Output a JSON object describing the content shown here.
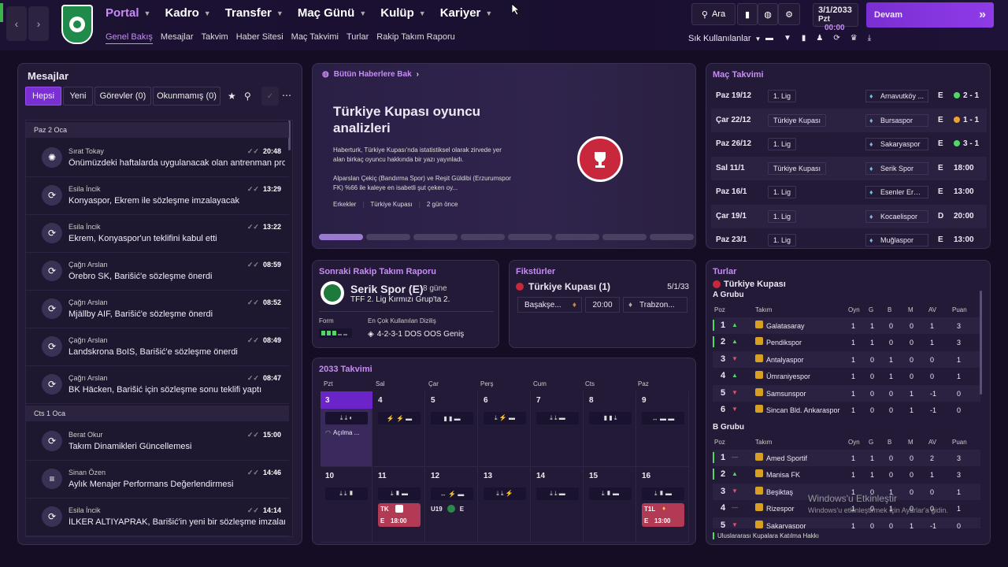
{
  "header": {
    "back_icon": "chevron-left-icon",
    "fwd_icon": "chevron-right-icon",
    "menu": [
      {
        "label": "Portal",
        "active": true
      },
      {
        "label": "Kadro"
      },
      {
        "label": "Transfer"
      },
      {
        "label": "Maç Günü"
      },
      {
        "label": "Kulüp"
      },
      {
        "label": "Kariyer"
      }
    ],
    "submenu": [
      "Genel Bakış",
      "Mesajlar",
      "Takvim",
      "Haber Sitesi",
      "Maç Takvimi",
      "Turlar",
      "Rakip Takım Raporu"
    ],
    "search_label": "Ara",
    "date": "3/1/2033",
    "day": "Pzt",
    "time": "00:00",
    "continue_label": "Devam",
    "quick_label": "Sık Kullanılanlar"
  },
  "messages": {
    "title": "Mesajlar",
    "filters": [
      "Hepsi",
      "Yeni",
      "Görevler (0)",
      "Okunmamış (0)"
    ],
    "groups": [
      {
        "date": "Paz 2 Oca",
        "items": [
          {
            "sender": "Sırat Tokay",
            "subject": "Önümüzdeki haftalarda uygulanacak olan antrenman pro...",
            "time": "20:48"
          },
          {
            "sender": "Esila İncik",
            "subject": "Konyaspor, Ekrem ile sözleşme imzalayacak",
            "time": "13:29"
          },
          {
            "sender": "Esila İncik",
            "subject": "Ekrem, Konyaspor'un teklifini kabul etti",
            "time": "13:22"
          },
          {
            "sender": "Çağrı Arslan",
            "subject": "Örebro SK, Barišić'e sözleşme önerdi",
            "time": "08:59"
          },
          {
            "sender": "Çağrı Arslan",
            "subject": "Mjällby AIF, Barišić'e sözleşme önerdi",
            "time": "08:52"
          },
          {
            "sender": "Çağrı Arslan",
            "subject": "Landskrona BoIS, Barišić'e sözleşme önerdi",
            "time": "08:49"
          },
          {
            "sender": "Çağrı Arslan",
            "subject": "BK Häcken, Barišić için sözleşme sonu teklifi yaptı",
            "time": "08:47"
          }
        ]
      },
      {
        "date": "Cts 1 Oca",
        "items": [
          {
            "sender": "Berat Okur",
            "subject": "Takım Dinamikleri Güncellemesi",
            "time": "15:00"
          },
          {
            "sender": "Sinan Özen",
            "subject": "Aylık Menajer Performans Değerlendirmesi",
            "time": "14:46"
          },
          {
            "sender": "Esila İncik",
            "subject": "İLKER ALTIYAPRAK, Barišić'in yeni bir sözleşme imzalamas...",
            "time": "14:14"
          }
        ]
      }
    ]
  },
  "news": {
    "link": "Bütün Haberlere Bak",
    "headline": "Türkiye Kupası oyuncu analizleri",
    "p1": "Haberturk, Türkiye Kupası'nda istatistiksel olarak zirvede yer alan birkaç oyuncu hakkında bir yazı yayınladı.",
    "p2": "Alparslan Çekiç (Bandırma Spor) ve Reşit Güldibi (Erzurumspor FK) %66 ile kaleye en isabetli şut çeken oy...",
    "tags": [
      "Erkekler",
      "Türkiye Kupası",
      "2 gün önce"
    ]
  },
  "fixtures": {
    "title": "Maç Takvimi",
    "rows": [
      {
        "date": "Paz 19/12",
        "comp": "1. Lig",
        "team": "Arnavutköy ...",
        "venue": "E",
        "result": "2 - 1",
        "res": "win"
      },
      {
        "date": "Çar 22/12",
        "comp": "Türkiye Kupası",
        "team": "Bursaspor",
        "venue": "E",
        "result": "1 - 1",
        "res": "draw"
      },
      {
        "date": "Paz 26/12",
        "comp": "1. Lig",
        "team": "Sakaryaspor",
        "venue": "E",
        "result": "3 - 1",
        "res": "win"
      },
      {
        "date": "Sal 11/1",
        "comp": "Türkiye Kupası",
        "team": "Serik Spor",
        "venue": "E",
        "result": "18:00"
      },
      {
        "date": "Paz 16/1",
        "comp": "1. Lig",
        "team": "Esenler Erok...",
        "venue": "E",
        "result": "13:00"
      },
      {
        "date": "Çar 19/1",
        "comp": "1. Lig",
        "team": "Kocaelispor",
        "venue": "D",
        "result": "20:00"
      },
      {
        "date": "Paz 23/1",
        "comp": "1. Lig",
        "team": "Muğlaspor",
        "venue": "E",
        "result": "13:00"
      }
    ]
  },
  "opp": {
    "title": "Sonraki Rakip Takım Raporu",
    "team": "Serik Spor (E)",
    "when": "8 güne",
    "league": "TFF 2. Lig Kırmızı Grup'ta 2.",
    "form_label": "Form",
    "formation_label": "En Çok Kullanılan Diziliş",
    "formation": "4-2-3-1 DOS OOS Geniş"
  },
  "fixtures2": {
    "title": "Fikstürler",
    "comp": "Türkiye Kupası (1)",
    "date": "5/1/33",
    "home": "Başakşe...",
    "time": "20:00",
    "away": "Trabzon..."
  },
  "calendar": {
    "title": "2033 Takvimi",
    "days": [
      "Pzt",
      "Sal",
      "Çar",
      "Perş",
      "Cum",
      "Cts",
      "Paz"
    ],
    "week1": [
      "3",
      "4",
      "5",
      "6",
      "7",
      "8",
      "9"
    ],
    "week2": [
      "10",
      "11",
      "12",
      "13",
      "14",
      "15",
      "16"
    ],
    "opening": "Açılma ...",
    "ev11": {
      "comp": "TK",
      "venue": "E",
      "time": "18:00"
    },
    "ev12": {
      "comp": "U19",
      "venue": "E"
    },
    "ev16": {
      "comp": "T1L",
      "venue": "E",
      "time": "13:00"
    }
  },
  "groups": {
    "title": "Turlar",
    "comp": "Türkiye Kupası",
    "cols": [
      "Poz",
      "Takım",
      "Oyn",
      "G",
      "B",
      "M",
      "AV",
      "Puan"
    ],
    "a": {
      "name": "A Grubu",
      "rows": [
        {
          "pos": "1",
          "team": "Galatasaray",
          "oyn": "1",
          "g": "1",
          "b": "0",
          "m": "0",
          "av": "1",
          "p": "3",
          "arrow": "up"
        },
        {
          "pos": "2",
          "team": "Pendikspor",
          "oyn": "1",
          "g": "1",
          "b": "0",
          "m": "0",
          "av": "1",
          "p": "3",
          "arrow": "up"
        },
        {
          "pos": "3",
          "team": "Antalyaspor",
          "oyn": "1",
          "g": "0",
          "b": "1",
          "m": "0",
          "av": "0",
          "p": "1",
          "arrow": "down"
        },
        {
          "pos": "4",
          "team": "Ümraniyespor",
          "oyn": "1",
          "g": "0",
          "b": "1",
          "m": "0",
          "av": "0",
          "p": "1",
          "arrow": "up"
        },
        {
          "pos": "5",
          "team": "Samsunspor",
          "oyn": "1",
          "g": "0",
          "b": "0",
          "m": "1",
          "av": "-1",
          "p": "0",
          "arrow": "down"
        },
        {
          "pos": "6",
          "team": "Sincan Bld. Ankaraspor",
          "oyn": "1",
          "g": "0",
          "b": "0",
          "m": "1",
          "av": "-1",
          "p": "0",
          "arrow": "down"
        }
      ]
    },
    "b": {
      "name": "B Grubu",
      "rows": [
        {
          "pos": "1",
          "team": "Amed Sportif",
          "oyn": "1",
          "g": "1",
          "b": "0",
          "m": "0",
          "av": "2",
          "p": "3",
          "arrow": "flat"
        },
        {
          "pos": "2",
          "team": "Manisa FK",
          "oyn": "1",
          "g": "1",
          "b": "0",
          "m": "0",
          "av": "1",
          "p": "3",
          "arrow": "up"
        },
        {
          "pos": "3",
          "team": "Beşiktaş",
          "oyn": "1",
          "g": "0",
          "b": "1",
          "m": "0",
          "av": "0",
          "p": "1",
          "arrow": "down"
        },
        {
          "pos": "4",
          "team": "Rizespor",
          "oyn": "1",
          "g": "0",
          "b": "1",
          "m": "0",
          "av": "0",
          "p": "1",
          "arrow": "flat"
        },
        {
          "pos": "5",
          "team": "Sakaryaspor",
          "oyn": "1",
          "g": "0",
          "b": "0",
          "m": "1",
          "av": "-1",
          "p": "0",
          "arrow": "down"
        }
      ]
    },
    "footer": "Uluslararası Kupalara Katılma Hakkı"
  },
  "watermark": {
    "line1": "Windows'u Etkinleştir",
    "line2": "Windows'u etkinleştirmek için Ayarlar'a gidin."
  },
  "colors": {
    "accent": "#c78cf5",
    "button": "#7a2fd2",
    "win": "#4cd964",
    "draw": "#f0a030",
    "cup": "#b23a54"
  }
}
